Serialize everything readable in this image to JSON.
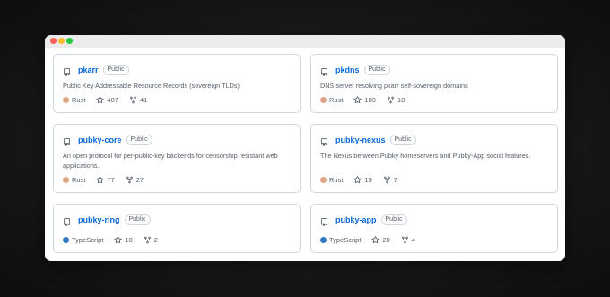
{
  "colors": {
    "traffic_close": "#fe5f57",
    "traffic_min": "#febc2e",
    "traffic_max": "#28c840",
    "link": "#0969da",
    "rust": "#dea584",
    "typescript": "#3178c6"
  },
  "icons": {
    "repo": "repo-icon",
    "star": "star-icon",
    "fork": "fork-icon"
  },
  "repos": [
    {
      "name": "pkarr",
      "visibility": "Public",
      "description": "Public Key Addressable Resource Records (sovereign TLDs)",
      "language": "Rust",
      "language_color": "#dea584",
      "stars": "407",
      "forks": "41"
    },
    {
      "name": "pkdns",
      "visibility": "Public",
      "description": "DNS server resolving pkarr self-sovereign domains",
      "language": "Rust",
      "language_color": "#dea584",
      "stars": "189",
      "forks": "18"
    },
    {
      "name": "pubky-core",
      "visibility": "Public",
      "description": "An open protocol for per-public-key backends for censorship resistant web applications.",
      "language": "Rust",
      "language_color": "#dea584",
      "stars": "77",
      "forks": "27"
    },
    {
      "name": "pubky-nexus",
      "visibility": "Public",
      "description": "The Nexus between Pubky homeservers and Pubky-App social features.",
      "language": "Rust",
      "language_color": "#dea584",
      "stars": "19",
      "forks": "7"
    },
    {
      "name": "pubky-ring",
      "visibility": "Public",
      "description": "",
      "language": "TypeScript",
      "language_color": "#3178c6",
      "stars": "10",
      "forks": "2"
    },
    {
      "name": "pubky-app",
      "visibility": "Public",
      "description": "",
      "language": "TypeScript",
      "language_color": "#3178c6",
      "stars": "20",
      "forks": "4"
    }
  ]
}
